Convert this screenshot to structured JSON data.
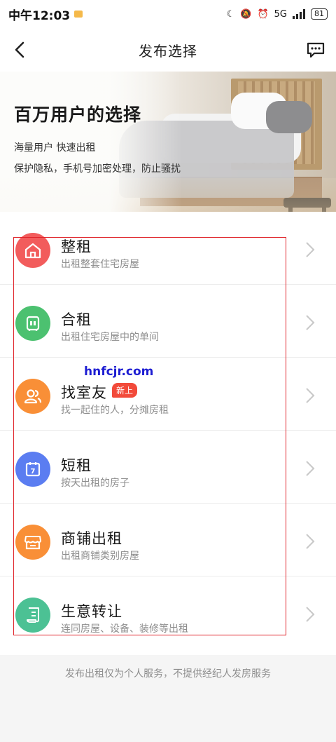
{
  "status_bar": {
    "time": "中午12:03",
    "network": "5G",
    "battery": "81"
  },
  "header": {
    "title": "发布选择"
  },
  "banner": {
    "title": "百万用户的选择",
    "line1": "海量用户   快速出租",
    "line2": "保护隐私，手机号加密处理，防止骚扰"
  },
  "items": [
    {
      "title": "整租",
      "subtitle": "出租整套住宅房屋",
      "icon": "house-icon",
      "color": "#f25c5c"
    },
    {
      "title": "合租",
      "subtitle": "出租住宅房屋中的单间",
      "icon": "bed-icon",
      "color": "#4cc170"
    },
    {
      "title": "找室友",
      "subtitle": "找一起住的人，分摊房租",
      "icon": "people-icon",
      "color": "#f98f37",
      "badge": "新上"
    },
    {
      "title": "短租",
      "subtitle": "按天出租的房子",
      "icon": "calendar-icon",
      "color": "#5b7df1"
    },
    {
      "title": "商铺出租",
      "subtitle": "出租商铺类别房屋",
      "icon": "store-icon",
      "color": "#f98f37"
    },
    {
      "title": "生意转让",
      "subtitle": "连同房屋、设备、装修等出租",
      "icon": "contract-icon",
      "color": "#4cc194"
    }
  ],
  "watermark": "hnfcjr.com",
  "footer": {
    "note": "发布出租仅为个人服务，不提供经纪人发房服务"
  },
  "colors": {
    "accent_red": "#e0242b",
    "badge_red": "#f24a3a"
  }
}
